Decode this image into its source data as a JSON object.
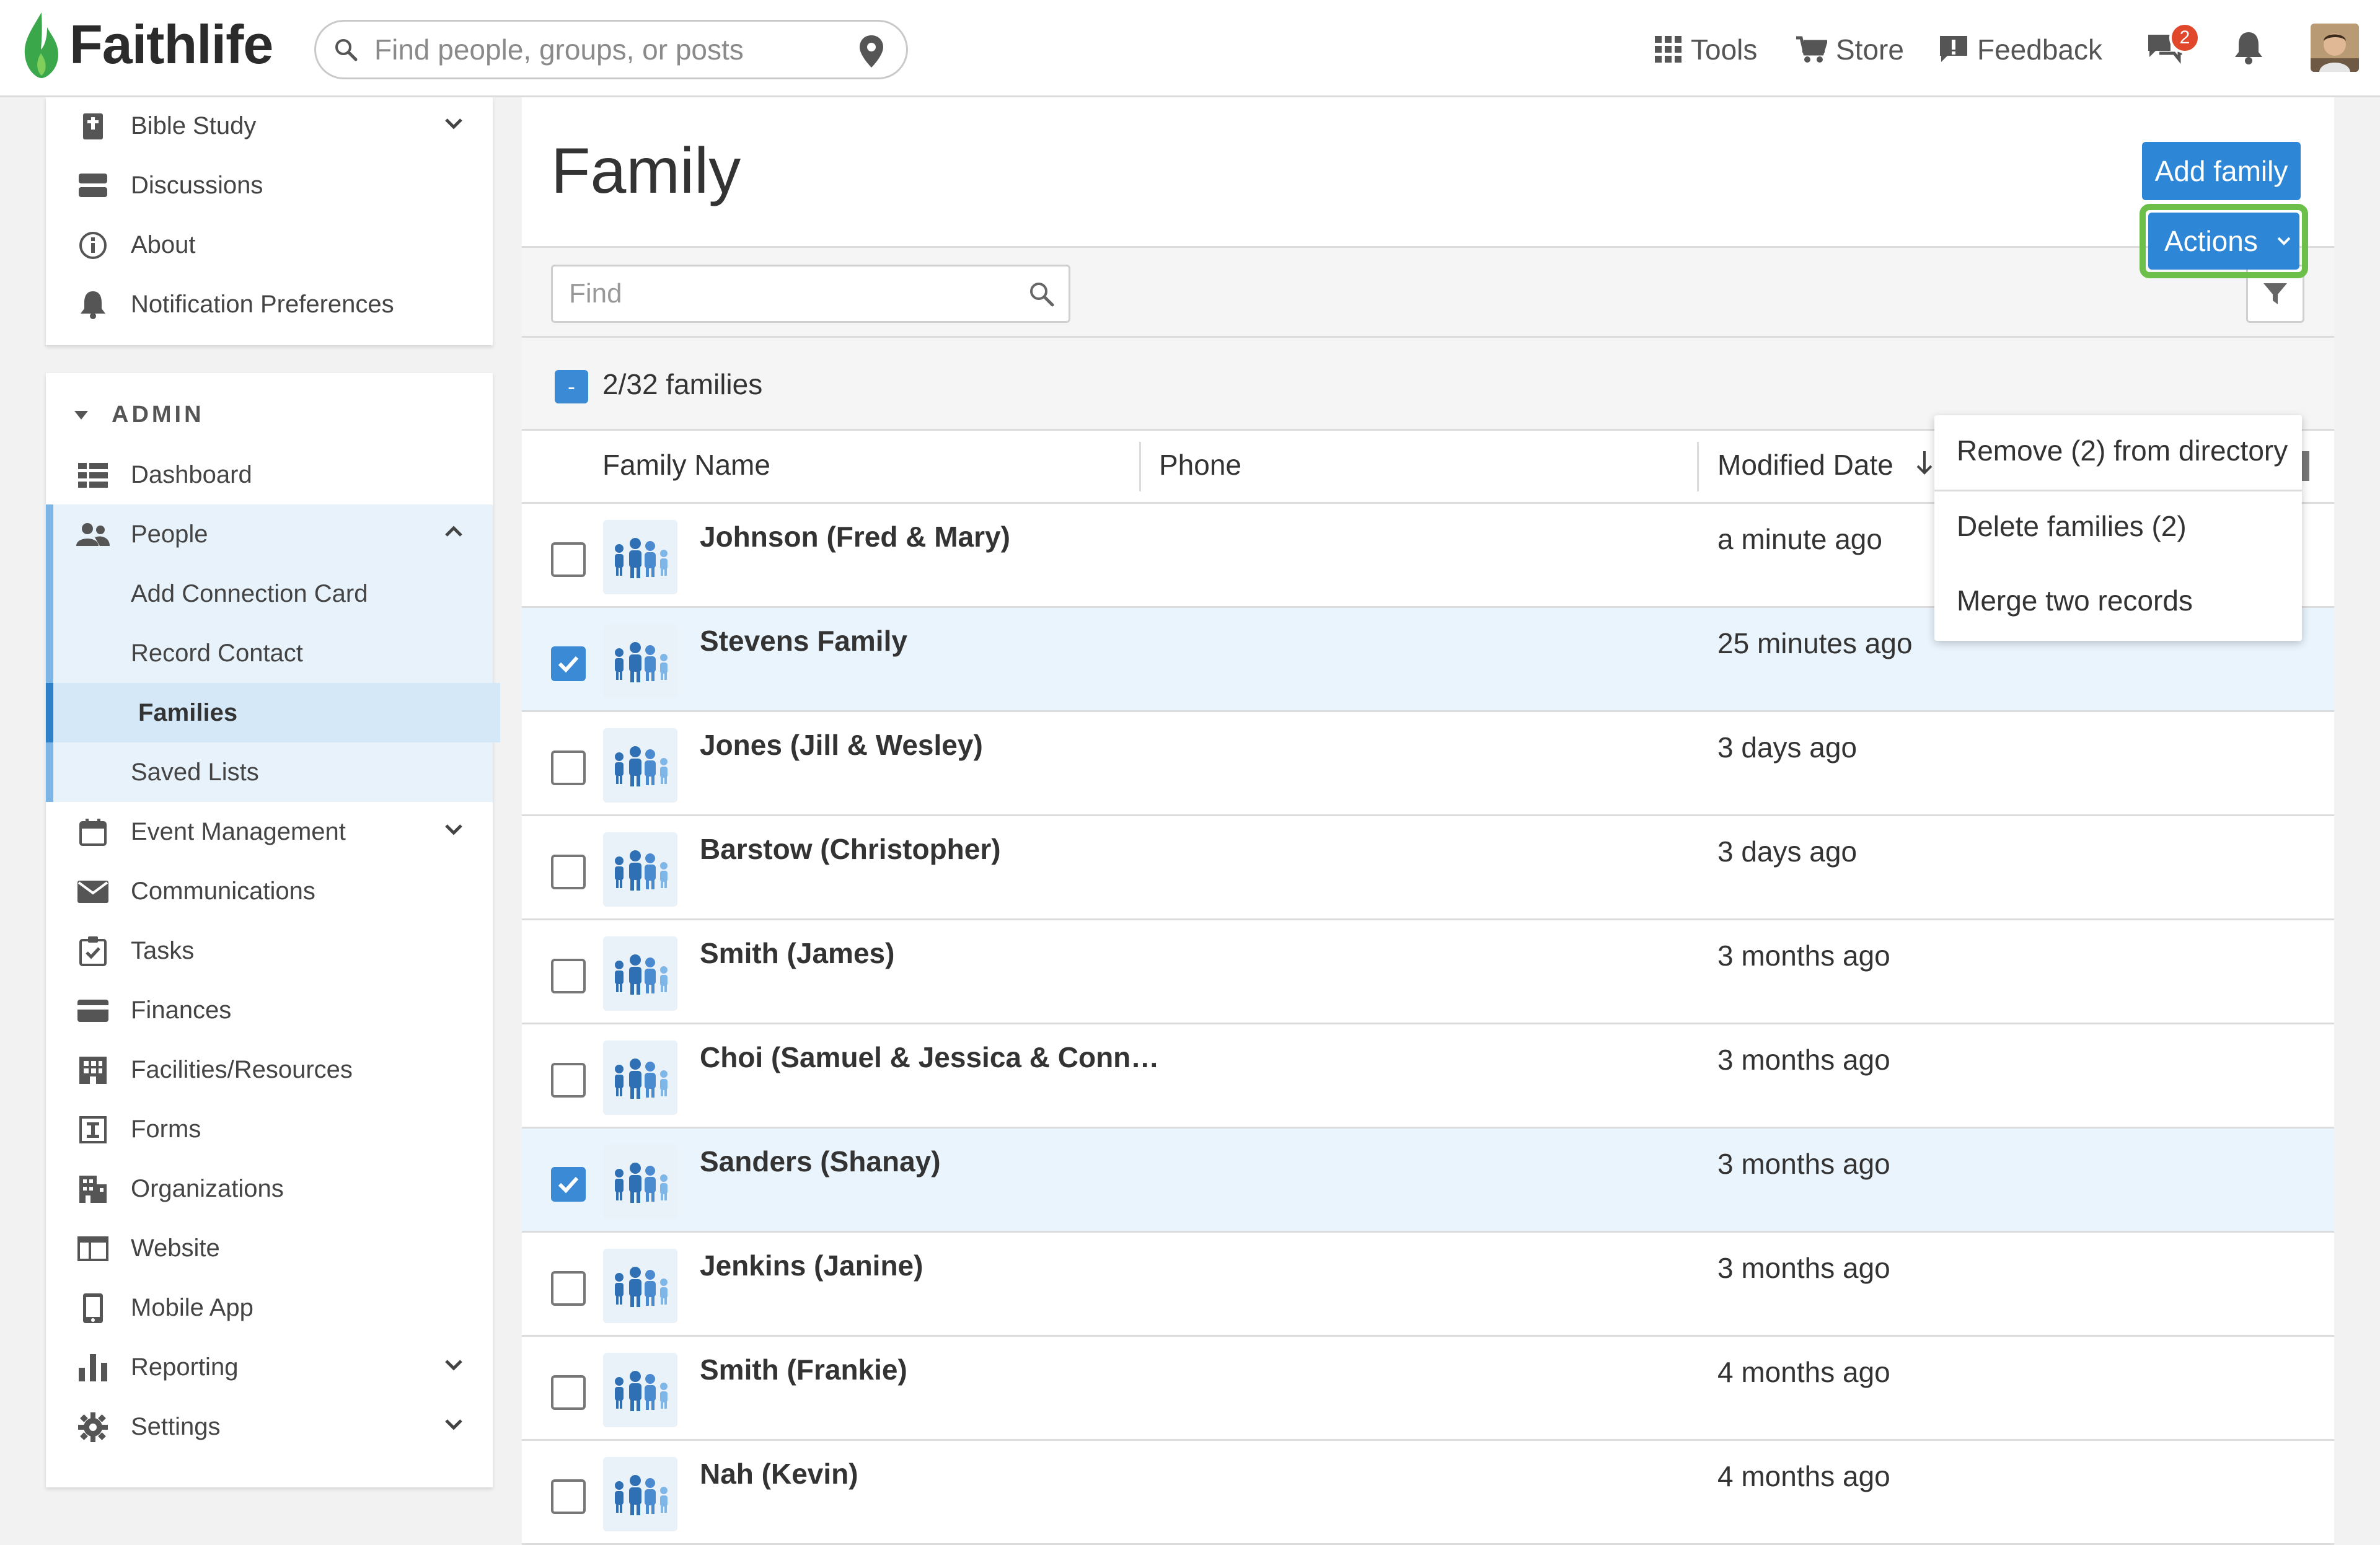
{
  "header": {
    "brand": "Faithlife",
    "search_placeholder": "Find people, groups, or posts",
    "nav": {
      "tools": "Tools",
      "store": "Store",
      "feedback": "Feedback"
    },
    "messages_badge": "2",
    "colors": {
      "brand_green": "#3aa84a"
    }
  },
  "sidebar": {
    "top_items": [
      {
        "label": "Bible Study",
        "icon": "bible-icon"
      },
      {
        "label": "Discussions",
        "icon": "discussions-icon"
      },
      {
        "label": "About",
        "icon": "info-icon"
      },
      {
        "label": "Notification Preferences",
        "icon": "bell-icon"
      }
    ],
    "admin_heading": "ADMIN",
    "admin_items": [
      {
        "label": "Dashboard",
        "icon": "dashboard-icon"
      },
      {
        "label": "People",
        "icon": "people-icon"
      },
      {
        "label": "Add Connection Card"
      },
      {
        "label": "Record Contact"
      },
      {
        "label": "Families",
        "active": true
      },
      {
        "label": "Saved Lists"
      },
      {
        "label": "Event Management",
        "icon": "calendar-icon"
      },
      {
        "label": "Communications",
        "icon": "envelope-icon"
      },
      {
        "label": "Tasks",
        "icon": "tasks-icon"
      },
      {
        "label": "Finances",
        "icon": "card-icon"
      },
      {
        "label": "Facilities/Resources",
        "icon": "building-icon"
      },
      {
        "label": "Forms",
        "icon": "forms-icon"
      },
      {
        "label": "Organizations",
        "icon": "organizations-icon"
      },
      {
        "label": "Website",
        "icon": "website-icon"
      },
      {
        "label": "Mobile App",
        "icon": "mobile-icon"
      },
      {
        "label": "Reporting",
        "icon": "reporting-icon"
      },
      {
        "label": "Settings",
        "icon": "gear-icon"
      }
    ]
  },
  "main": {
    "title": "Family",
    "add_button": "Add family",
    "find_placeholder": "Find",
    "count": "2/32 families",
    "actions_label": "Actions",
    "columns": {
      "name": "Family Name",
      "phone": "Phone",
      "modified": "Modified Date"
    },
    "rows": [
      {
        "name": "Johnson (Fred & Mary)",
        "modified": "a minute ago",
        "checked": false
      },
      {
        "name": "Stevens Family",
        "modified": "25 minutes ago",
        "checked": true
      },
      {
        "name": "Jones (Jill & Wesley)",
        "modified": "3 days ago",
        "checked": false
      },
      {
        "name": "Barstow (Christopher)",
        "modified": "3 days ago",
        "checked": false
      },
      {
        "name": "Smith (James)",
        "modified": "3 months ago",
        "checked": false
      },
      {
        "name": "Choi (Samuel & Jessica & Conn…",
        "modified": "3 months ago",
        "checked": false
      },
      {
        "name": "Sanders (Shanay)",
        "modified": "3 months ago",
        "checked": true
      },
      {
        "name": "Jenkins (Janine)",
        "modified": "3 months ago",
        "checked": false
      },
      {
        "name": "Smith (Frankie)",
        "modified": "4 months ago",
        "checked": false
      },
      {
        "name": "Nah (Kevin)",
        "modified": "4 months ago",
        "checked": false
      }
    ],
    "actions_menu": [
      "Remove (2) from directory",
      "Delete families (2)",
      "Merge two records"
    ],
    "colors": {
      "primary": "#2e86d6",
      "highlight_outline": "#6cc04a",
      "selected_row": "#eaf4fd"
    }
  }
}
